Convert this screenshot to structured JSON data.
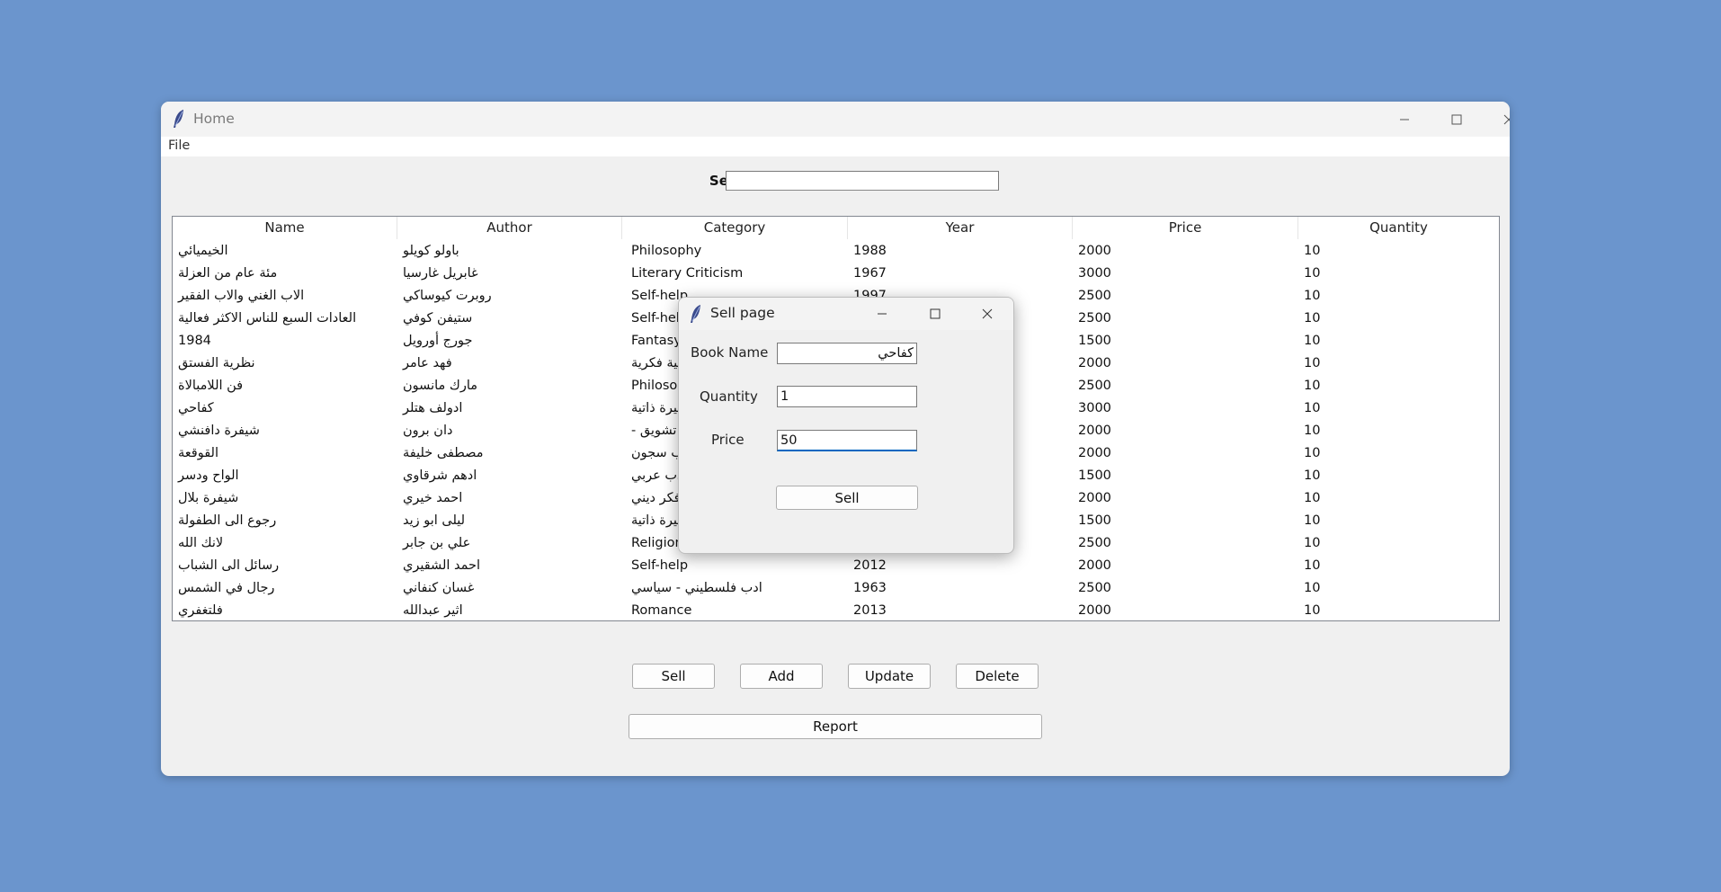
{
  "window": {
    "title": "Home",
    "menu": [
      "File"
    ]
  },
  "search": {
    "label": "Search",
    "value": ""
  },
  "table": {
    "columns": [
      "Name",
      "Author",
      "Category",
      "Year",
      "Price",
      "Quantity"
    ],
    "rows": [
      [
        "الخيميائي",
        "باولو كويلو",
        "Philosophy",
        "1988",
        "2000",
        "10"
      ],
      [
        "مئة عام من العزلة",
        "غابريل غارسيا",
        "Literary Criticism",
        "1967",
        "3000",
        "10"
      ],
      [
        "الاب الغني والاب الفقير",
        "روبرت كيوساكي",
        "Self-help",
        "1997",
        "2500",
        "10"
      ],
      [
        "العادات السبع للناس الاكثر فعالية",
        "ستيفن كوفي",
        "Self-help",
        "",
        "2500",
        "10"
      ],
      [
        "1984",
        "جورج أورويل",
        "Fantasy",
        "",
        "1500",
        "10"
      ],
      [
        "نظرية الفستق",
        "فهد عامر",
        "تنمية فكرية",
        "",
        "2000",
        "10"
      ],
      [
        "فن اللامبالاة",
        "مارك مانسون",
        "Philosophy",
        "",
        "2500",
        "10"
      ],
      [
        "كفاحي",
        "ادولف هتلر",
        "سيرة ذاتية",
        "",
        "3000",
        "10"
      ],
      [
        "شيفرة دافنشي",
        "دان برون",
        "- تشويق",
        "",
        "2000",
        "10"
      ],
      [
        "القوقعة",
        "مصطفى خليفة",
        "ادب سجون",
        "",
        "2000",
        "10"
      ],
      [
        "الواح ودسر",
        "ادهم شرقاوي",
        "ادب عربي",
        "",
        "1500",
        "10"
      ],
      [
        "شيفرة بلال",
        "احمد خيري",
        "فكر ديني",
        "",
        "2000",
        "10"
      ],
      [
        "رجوع الى الطفولة",
        "ليلى ابو زيد",
        "سيرة ذاتية",
        "",
        "1500",
        "10"
      ],
      [
        "لانك الله",
        "علي بن جابر",
        "Religion",
        "",
        "2500",
        "10"
      ],
      [
        "رسائل الى الشباب",
        "احمد الشقيري",
        "Self-help",
        "2012",
        "2000",
        "10"
      ],
      [
        "رجال في الشمس",
        "غسان كنفاني",
        "ادب فلسطيني - سياسي",
        "1963",
        "2500",
        "10"
      ],
      [
        "فلتغفري",
        "اثير عبدالله",
        "Romance",
        "2013",
        "2000",
        "10"
      ]
    ]
  },
  "buttons": {
    "sell": "Sell",
    "add": "Add",
    "update": "Update",
    "delete": "Delete",
    "report": "Report"
  },
  "dialog": {
    "title": "Sell page",
    "book_name_label": "Book Name",
    "book_name_value": "كفاحي",
    "quantity_label": "Quantity",
    "quantity_value": "1",
    "price_label": "Price",
    "price_value": "50",
    "sell_button": "Sell"
  },
  "colors": {
    "desktop": "#6b95cd",
    "window_bg": "#f0f0f0",
    "focus_accent": "#0067c0"
  },
  "icons": [
    "feather-icon",
    "minimize-icon",
    "maximize-icon",
    "close-icon"
  ]
}
